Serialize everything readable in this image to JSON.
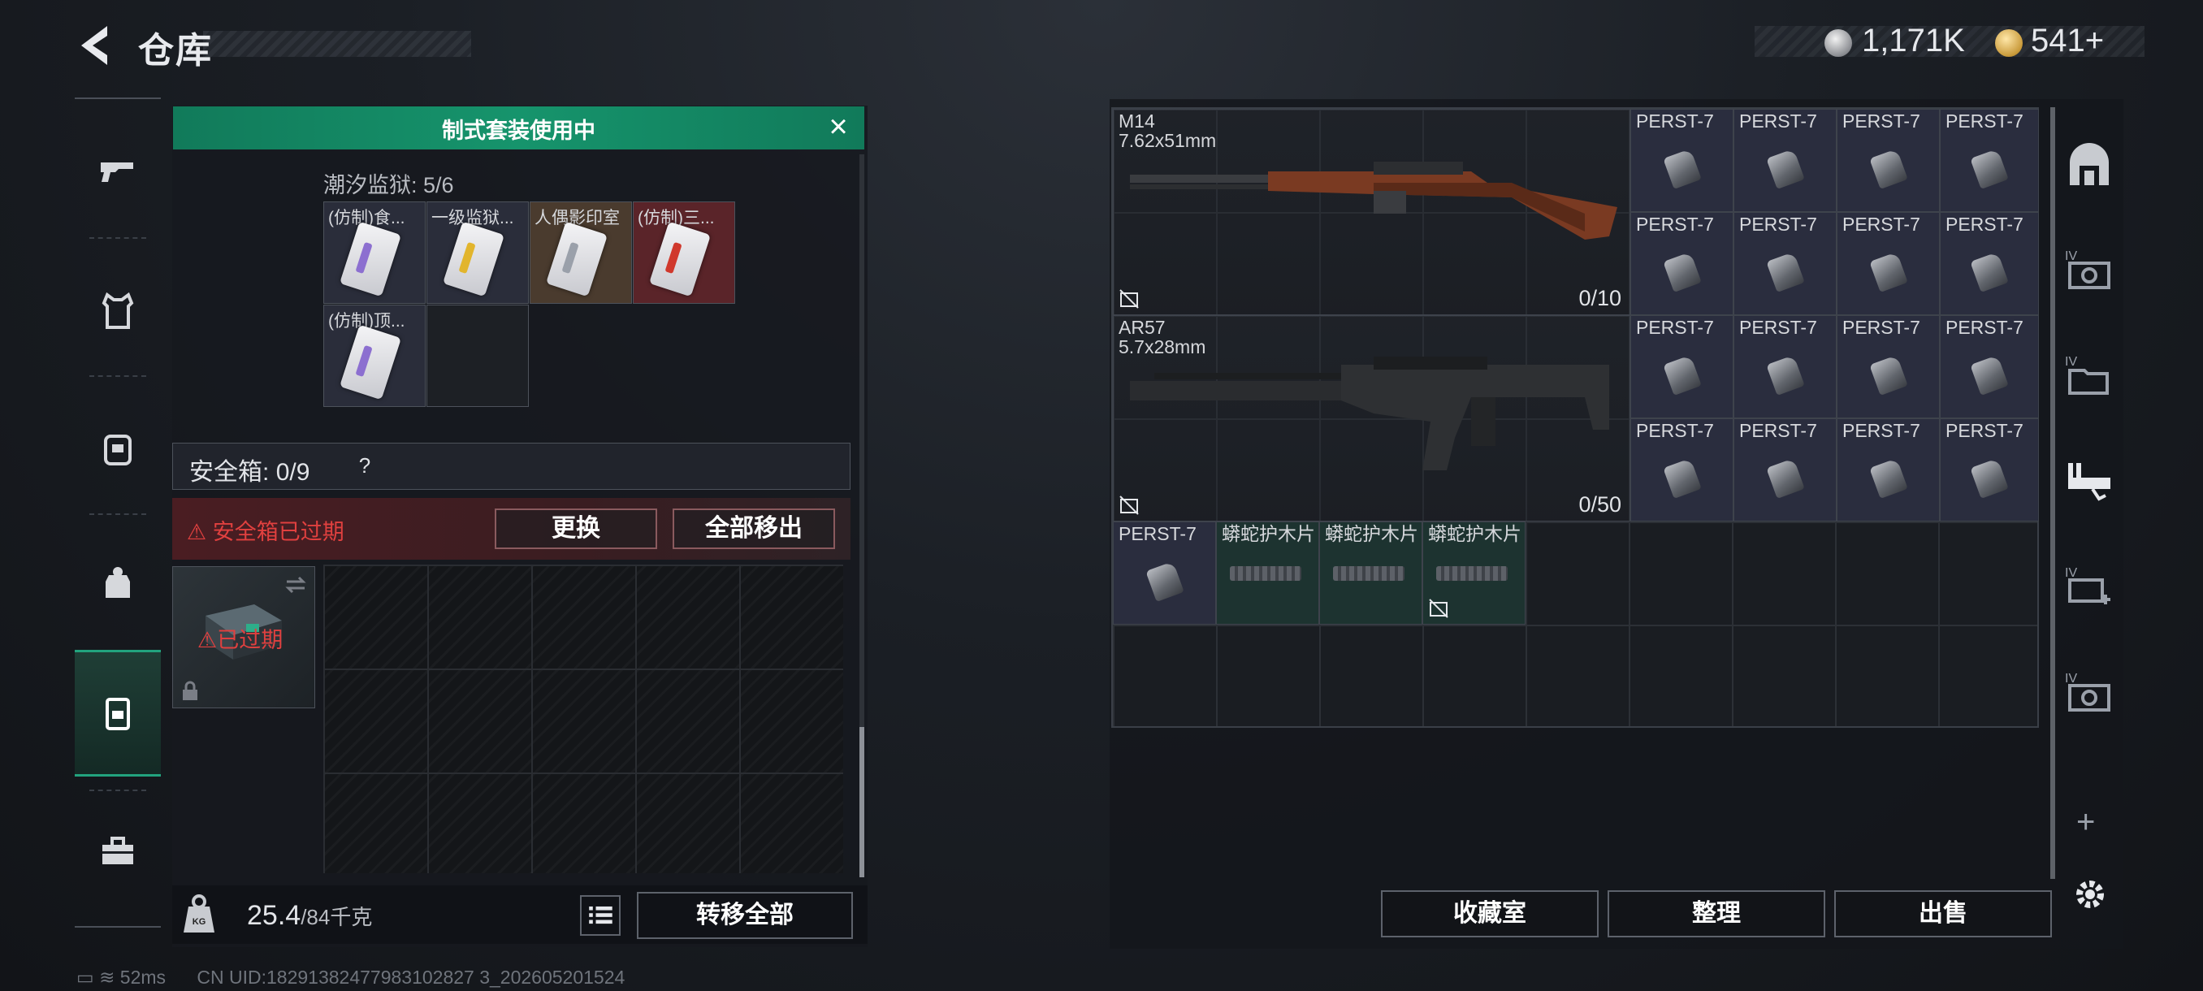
{
  "header": {
    "title": "仓库",
    "currency_silver": "1,171K",
    "currency_gold": "541+"
  },
  "left_panel": {
    "banner_text": "制式套装使用中",
    "set_title": "潮汐监狱: 5/6",
    "set_items": [
      {
        "label": "(仿制)食...",
        "color": "purple"
      },
      {
        "label": "一级监狱...",
        "color": "yellow"
      },
      {
        "label": "人偶影印室",
        "color": "gray"
      },
      {
        "label": "(仿制)三...",
        "color": "red"
      },
      {
        "label": "(仿制)顶...",
        "color": "purple"
      }
    ],
    "safebox_label": "安全箱:",
    "safebox_count": "0/9",
    "safebox_help": "?",
    "expired_text": "安全箱已过期",
    "replace_label": "更换",
    "remove_all_label": "全部移出",
    "safebox_expired_label": "已过期",
    "weight_value": "25.4",
    "weight_max": "/84千克",
    "transfer_all_label": "转移全部"
  },
  "inventory": {
    "weapons": [
      {
        "name": "M14",
        "caliber": "7.62x51mm",
        "count": "0/10"
      },
      {
        "name": "AR57",
        "caliber": "5.7x28mm",
        "count": "0/50"
      }
    ],
    "ammo_label": "PERST-7",
    "plate_label": "蟒蛇护木片"
  },
  "bottom_buttons": {
    "collection": "收藏室",
    "organize": "整理",
    "sell": "出售"
  },
  "status_bar": {
    "ping": "52ms",
    "uid": "CN UID:18291382477983102827 3_202605201524"
  },
  "colors": {
    "accent_green": "#16946c",
    "danger_red": "#e0403f",
    "ammo_bg": "#2a2d3e"
  }
}
